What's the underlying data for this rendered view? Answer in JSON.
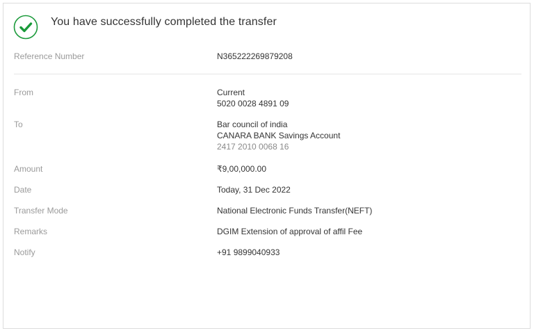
{
  "header": {
    "title": "You have successfully completed the transfer",
    "icon": "check-circle-icon",
    "accent_color": "#1a9a3a"
  },
  "reference": {
    "label": "Reference Number",
    "value": "N365222269879208"
  },
  "from": {
    "label": "From",
    "account_type": "Current",
    "account_number": "5020 0028 4891 09"
  },
  "to": {
    "label": "To",
    "payee_name": "Bar council of india",
    "bank_account": "CANARA BANK Savings Account",
    "account_number": "2417 2010 0068 16"
  },
  "amount": {
    "label": "Amount",
    "value": "₹9,00,000.00"
  },
  "date": {
    "label": "Date",
    "value": "Today, 31 Dec 2022"
  },
  "transfer_mode": {
    "label": "Transfer Mode",
    "value": "National Electronic Funds Transfer(NEFT)"
  },
  "remarks": {
    "label": "Remarks",
    "value": "DGIM Extension of approval of affil Fee"
  },
  "notify": {
    "label": "Notify",
    "value": "+91 9899040933"
  }
}
